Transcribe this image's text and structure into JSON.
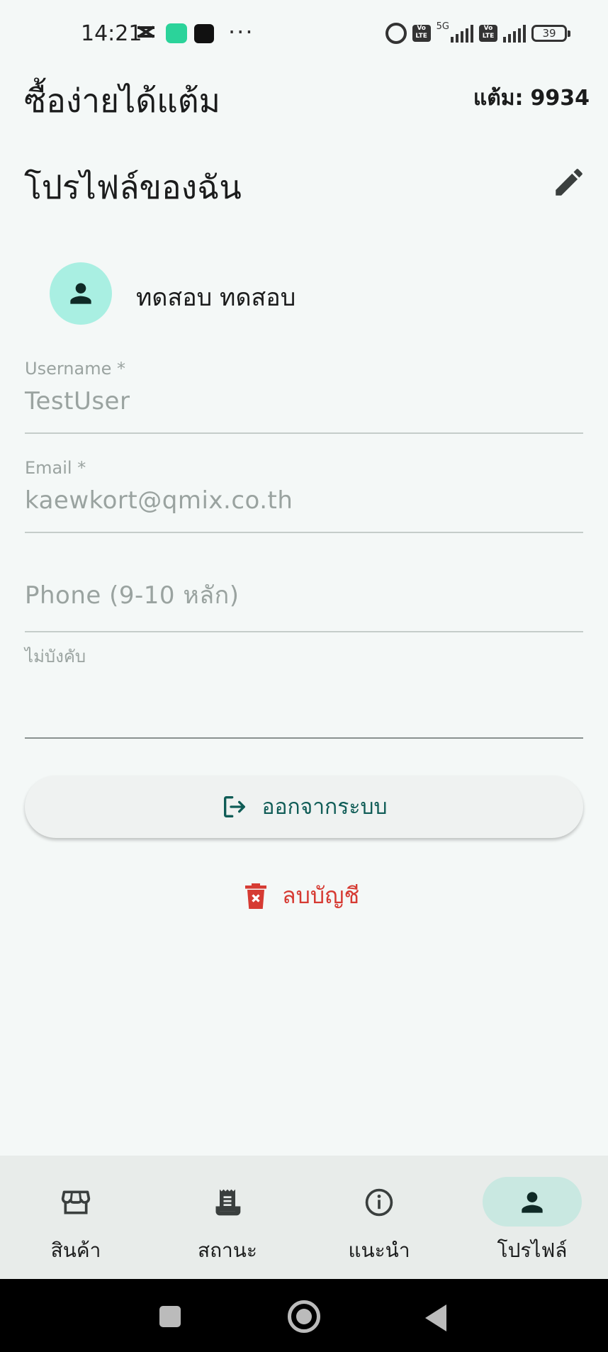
{
  "status_bar": {
    "time": "14:21",
    "overflow": "···",
    "network": "5G",
    "volte": "Vo LTE",
    "battery": "39",
    "icons": [
      "capcut-icon",
      "app-green-icon",
      "app-black-icon",
      "alarm-icon",
      "volte-icon",
      "signal-icon",
      "battery-icon"
    ]
  },
  "header": {
    "app_title": "ซื้อง่ายได้แต้ม",
    "points_label": "แต้ม:",
    "points_value": "9934"
  },
  "profile": {
    "section_title": "โปรไฟล์ของฉัน",
    "edit_icon": "pencil-icon",
    "display_name": "ทดสอบ ทดสอบ",
    "avatar_icon": "person-icon"
  },
  "form": {
    "username_label": "Username *",
    "username_value": "TestUser",
    "email_label": "Email *",
    "email_value": "kaewkort@qmix.co.th",
    "phone_placeholder": "Phone (9-10 หลัก)",
    "phone_hint": "ไม่บังคับ"
  },
  "actions": {
    "logout_label": "ออกจากระบบ",
    "delete_label": "ลบบัญชี"
  },
  "colors": {
    "accent": "#0f5c56",
    "danger": "#d63b33",
    "avatar_bg": "#a9efe2",
    "nav_active": "#c9e8e1"
  },
  "bottom_nav": {
    "items": [
      {
        "label": "สินค้า",
        "icon": "store-icon"
      },
      {
        "label": "สถานะ",
        "icon": "receipt-icon"
      },
      {
        "label": "แนะนำ",
        "icon": "info-icon"
      },
      {
        "label": "โปรไฟล์",
        "icon": "person-icon"
      }
    ],
    "active_index": 3
  }
}
